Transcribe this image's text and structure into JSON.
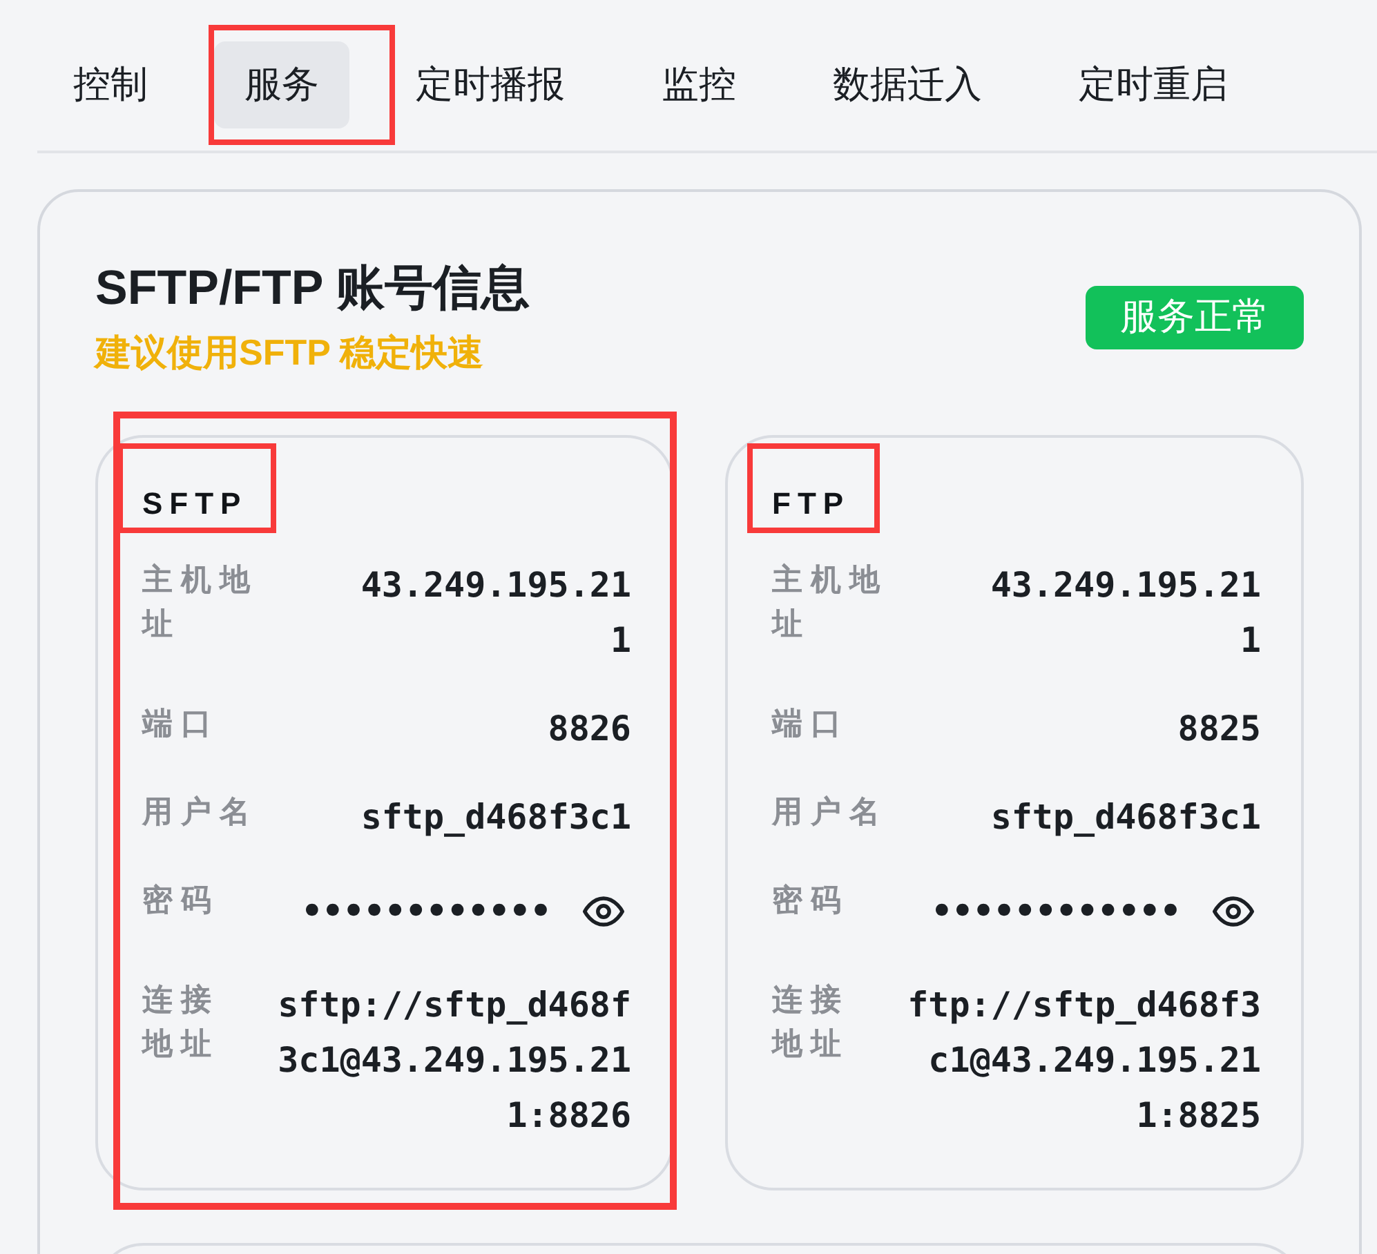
{
  "tabs": [
    {
      "label": "控制",
      "selected": false,
      "highlighted": false
    },
    {
      "label": "服务",
      "selected": true,
      "highlighted": true
    },
    {
      "label": "定时播报",
      "selected": false,
      "highlighted": false
    },
    {
      "label": "监控",
      "selected": false,
      "highlighted": false
    },
    {
      "label": "数据迁入",
      "selected": false,
      "highlighted": false
    },
    {
      "label": "定时重启",
      "selected": false,
      "highlighted": false
    }
  ],
  "panel": {
    "title": "SFTP/FTP 账号信息",
    "subtitle": "建议使用SFTP 稳定快速",
    "status": {
      "label": "服务正常",
      "healthy": true
    },
    "accounts": [
      {
        "title": "SFTP",
        "highlighted": true,
        "title_highlighted": true,
        "fields": [
          {
            "kind": "text",
            "label": "主机地址",
            "value": "43.249.195.211"
          },
          {
            "kind": "text",
            "label": "端口",
            "value": "8826"
          },
          {
            "kind": "text",
            "label": "用户名",
            "value": "sftp_d468f3c1"
          },
          {
            "kind": "secret",
            "label": "密码",
            "value": "••••••••••••"
          },
          {
            "kind": "url",
            "label": "连接地址",
            "value": "sftp://sftp_d468f3c1@43.249.195.211:8826"
          }
        ]
      },
      {
        "title": "FTP",
        "highlighted": false,
        "title_highlighted": true,
        "fields": [
          {
            "kind": "text",
            "label": "主机地址",
            "value": "43.249.195.211"
          },
          {
            "kind": "text",
            "label": "端口",
            "value": "8825"
          },
          {
            "kind": "text",
            "label": "用户名",
            "value": "sftp_d468f3c1"
          },
          {
            "kind": "secret",
            "label": "密码",
            "value": "••••••••••••"
          },
          {
            "kind": "url",
            "label": "连接地址",
            "value": "ftp://sftp_d468f3c1@43.249.195.211:8825"
          }
        ]
      }
    ]
  }
}
